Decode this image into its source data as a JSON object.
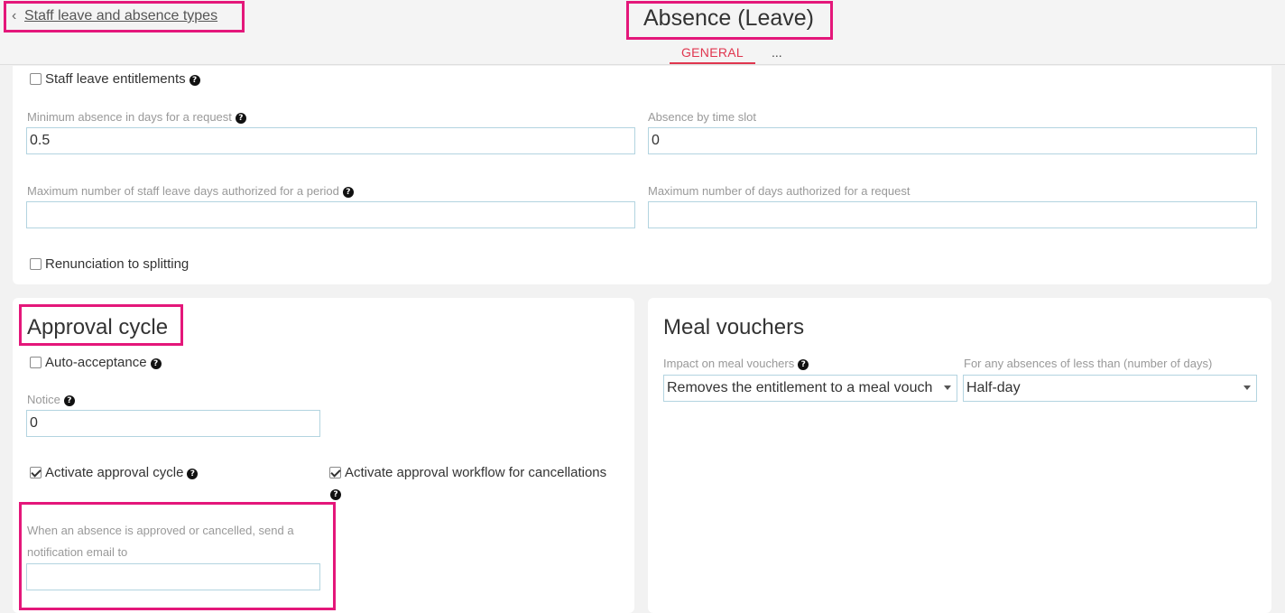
{
  "header": {
    "back_label": "Staff leave and absence types",
    "title": "Absence (Leave)",
    "tabs": {
      "general": "GENERAL",
      "more": "..."
    }
  },
  "general": {
    "staff_leave_entitlements": {
      "label": "Staff leave entitlements",
      "checked": false
    },
    "min_absence": {
      "label": "Minimum absence in days for a request",
      "value": "0.5"
    },
    "absence_by_time_slot": {
      "label": "Absence by time slot",
      "value": "0"
    },
    "max_staff_leave_days": {
      "label": "Maximum number of staff leave days authorized for a period",
      "value": ""
    },
    "max_days_request": {
      "label": "Maximum number of days authorized for a request",
      "value": ""
    },
    "renunciation_splitting": {
      "label": "Renunciation to splitting",
      "checked": false
    }
  },
  "approval": {
    "title": "Approval cycle",
    "auto_acceptance": {
      "label": "Auto-acceptance",
      "checked": false
    },
    "notice": {
      "label": "Notice",
      "value": "0"
    },
    "activate_cycle": {
      "label": "Activate approval cycle",
      "checked": true
    },
    "activate_cancellations": {
      "label": "Activate approval workflow for cancellations",
      "checked": true
    },
    "notify_email": {
      "label": "When an absence is approved or cancelled, send a notification email to",
      "value": ""
    }
  },
  "meal": {
    "title": "Meal vouchers",
    "impact": {
      "label": "Impact on meal vouchers",
      "value": "Removes the entitlement to a meal vouch"
    },
    "less_than": {
      "label": "For any absences of less than (number of days)",
      "value": "Half-day"
    }
  },
  "help_icon_glyph": "?",
  "colors": {
    "accent": "#e0364f",
    "highlight": "#e4177a",
    "input_border": "#b3d4e0"
  }
}
